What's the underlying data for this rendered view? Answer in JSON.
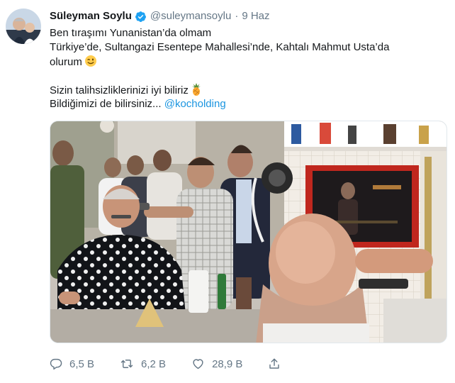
{
  "tweet": {
    "name": "Süleyman Soylu",
    "handle": "@suleymansoylu",
    "separator": "·",
    "time": "9 Haz",
    "lines": [
      "Ben tıraşımı Yunanistan’da olmam",
      "Türkiye’de, Sultangazi Esentepe Mahallesi’nde, Kahtalı Mahmut Usta’da",
      "olurum",
      "Sizin talihsizliklerinizi iyi biliriz",
      "Bildiğimizi de bilirsiniz..."
    ],
    "mention": "@kocholding",
    "emojis": [
      "winking-face-emoji",
      "pineapple-emoji"
    ]
  },
  "actions": {
    "reply": {
      "icon": "reply-icon",
      "count": "6,5 B"
    },
    "retweet": {
      "icon": "retweet-icon",
      "count": "6,2 B"
    },
    "like": {
      "icon": "heart-icon",
      "count": "28,9 B"
    },
    "share": {
      "icon": "share-icon"
    }
  },
  "colors": {
    "text": "#14171a",
    "secondary": "#657786",
    "link": "#1b95e0",
    "verified": "#1da1f2"
  }
}
